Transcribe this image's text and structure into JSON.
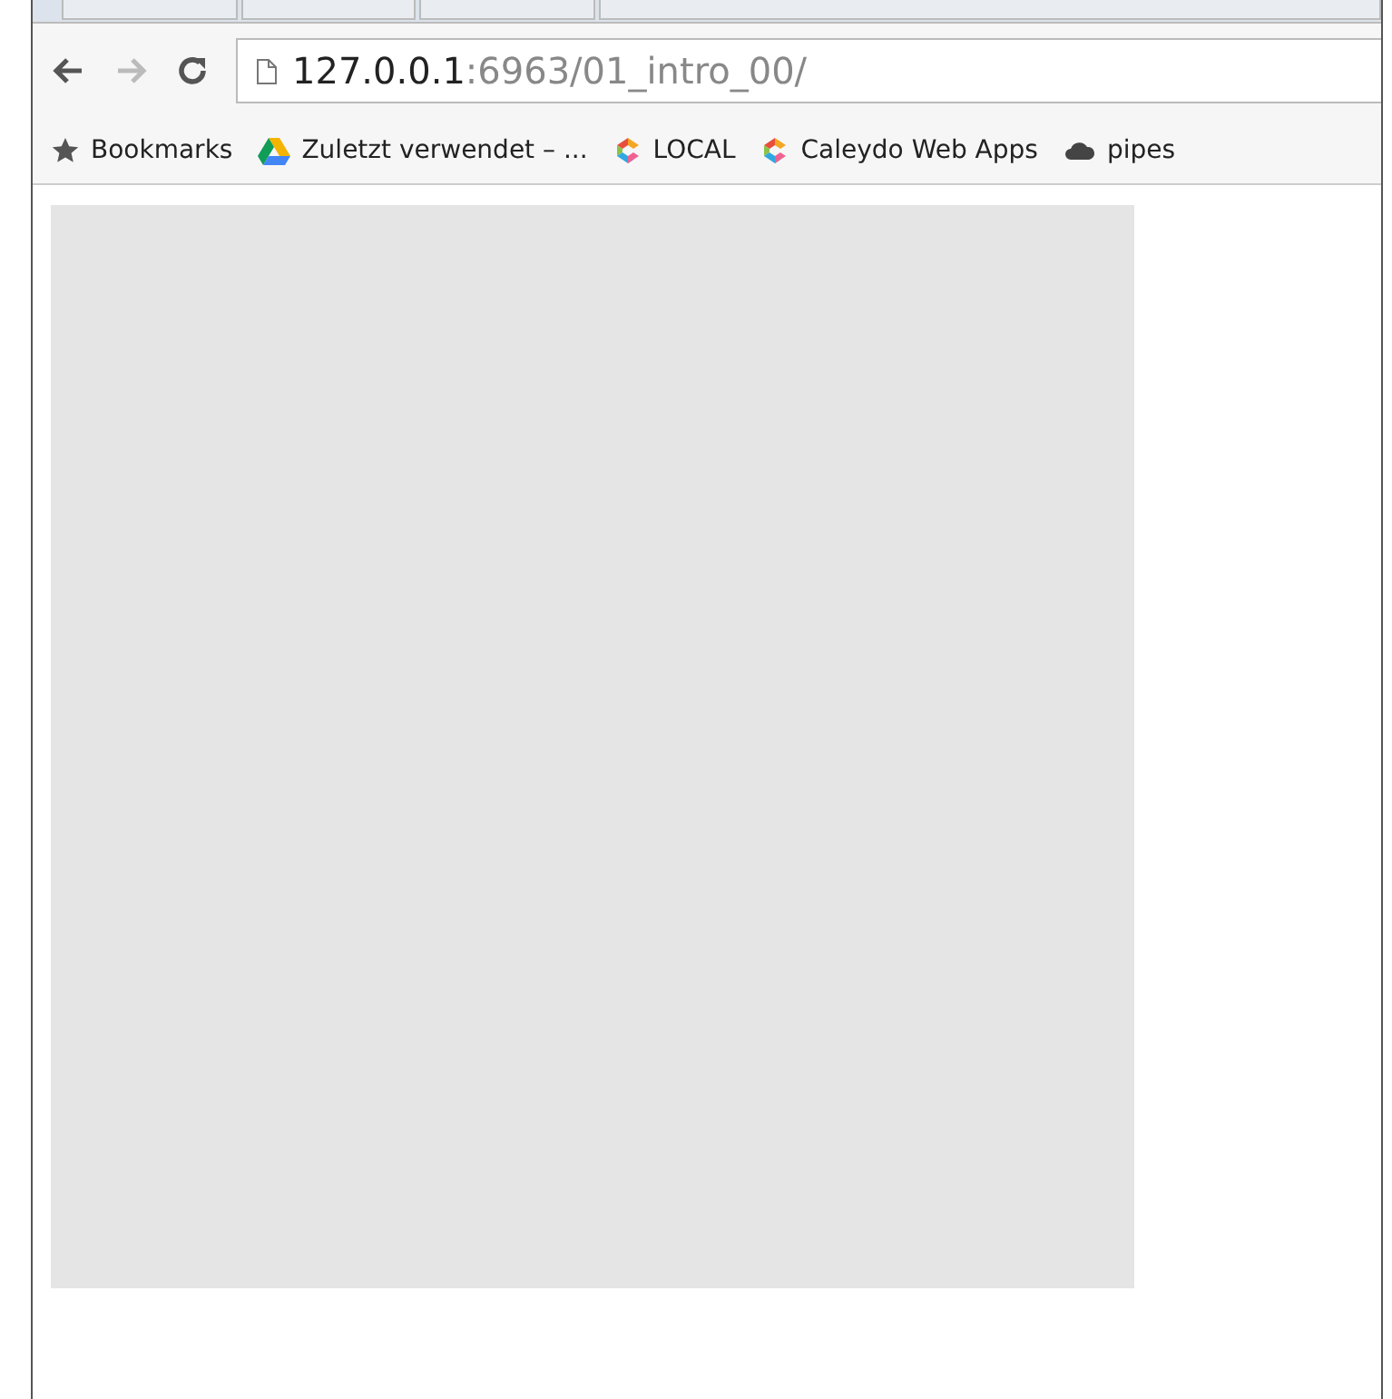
{
  "toolbar": {
    "back": {
      "disabled": false
    },
    "forward": {
      "disabled": true
    },
    "address": {
      "host": "127.0.0.1",
      "path": ":6963/01_intro_00/"
    }
  },
  "bookmarks": [
    {
      "label": "Bookmarks",
      "kind": "star"
    },
    {
      "label": "Zuletzt verwendet – ...",
      "kind": "drive"
    },
    {
      "label": "LOCAL",
      "kind": "caleydo"
    },
    {
      "label": "Caleydo Web Apps",
      "kind": "caleydo"
    },
    {
      "label": "pipes",
      "kind": "cloud"
    }
  ]
}
